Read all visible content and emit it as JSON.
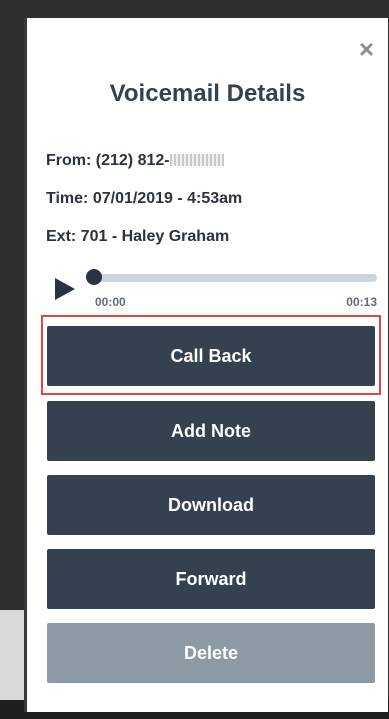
{
  "dialog": {
    "title": "Voicemail Details",
    "close_glyph": "×",
    "from_label": "From: (212) 812-",
    "time_label": "Time: 07/01/2019 - 4:53am",
    "ext_label": "Ext: 701 - Haley Graham"
  },
  "player": {
    "current_time": "00:00",
    "duration": "00:13",
    "progress": 0
  },
  "actions": {
    "call_back": "Call Back",
    "add_note": "Add Note",
    "download": "Download",
    "forward": "Forward",
    "delete": "Delete"
  },
  "colors": {
    "button": "#364150",
    "button_disabled": "#8e99a6",
    "highlight": "#e0473f"
  },
  "icons": {
    "close": "close-icon",
    "play": "play-icon"
  }
}
